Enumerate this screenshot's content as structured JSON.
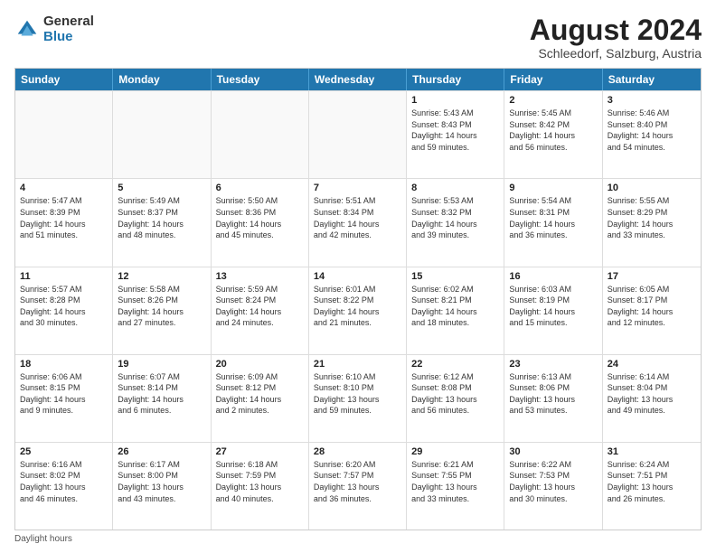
{
  "logo": {
    "general": "General",
    "blue": "Blue"
  },
  "title": "August 2024",
  "subtitle": "Schleedorf, Salzburg, Austria",
  "header_days": [
    "Sunday",
    "Monday",
    "Tuesday",
    "Wednesday",
    "Thursday",
    "Friday",
    "Saturday"
  ],
  "footer": "Daylight hours",
  "weeks": [
    [
      {
        "day": "",
        "info": ""
      },
      {
        "day": "",
        "info": ""
      },
      {
        "day": "",
        "info": ""
      },
      {
        "day": "",
        "info": ""
      },
      {
        "day": "1",
        "info": "Sunrise: 5:43 AM\nSunset: 8:43 PM\nDaylight: 14 hours\nand 59 minutes."
      },
      {
        "day": "2",
        "info": "Sunrise: 5:45 AM\nSunset: 8:42 PM\nDaylight: 14 hours\nand 56 minutes."
      },
      {
        "day": "3",
        "info": "Sunrise: 5:46 AM\nSunset: 8:40 PM\nDaylight: 14 hours\nand 54 minutes."
      }
    ],
    [
      {
        "day": "4",
        "info": "Sunrise: 5:47 AM\nSunset: 8:39 PM\nDaylight: 14 hours\nand 51 minutes."
      },
      {
        "day": "5",
        "info": "Sunrise: 5:49 AM\nSunset: 8:37 PM\nDaylight: 14 hours\nand 48 minutes."
      },
      {
        "day": "6",
        "info": "Sunrise: 5:50 AM\nSunset: 8:36 PM\nDaylight: 14 hours\nand 45 minutes."
      },
      {
        "day": "7",
        "info": "Sunrise: 5:51 AM\nSunset: 8:34 PM\nDaylight: 14 hours\nand 42 minutes."
      },
      {
        "day": "8",
        "info": "Sunrise: 5:53 AM\nSunset: 8:32 PM\nDaylight: 14 hours\nand 39 minutes."
      },
      {
        "day": "9",
        "info": "Sunrise: 5:54 AM\nSunset: 8:31 PM\nDaylight: 14 hours\nand 36 minutes."
      },
      {
        "day": "10",
        "info": "Sunrise: 5:55 AM\nSunset: 8:29 PM\nDaylight: 14 hours\nand 33 minutes."
      }
    ],
    [
      {
        "day": "11",
        "info": "Sunrise: 5:57 AM\nSunset: 8:28 PM\nDaylight: 14 hours\nand 30 minutes."
      },
      {
        "day": "12",
        "info": "Sunrise: 5:58 AM\nSunset: 8:26 PM\nDaylight: 14 hours\nand 27 minutes."
      },
      {
        "day": "13",
        "info": "Sunrise: 5:59 AM\nSunset: 8:24 PM\nDaylight: 14 hours\nand 24 minutes."
      },
      {
        "day": "14",
        "info": "Sunrise: 6:01 AM\nSunset: 8:22 PM\nDaylight: 14 hours\nand 21 minutes."
      },
      {
        "day": "15",
        "info": "Sunrise: 6:02 AM\nSunset: 8:21 PM\nDaylight: 14 hours\nand 18 minutes."
      },
      {
        "day": "16",
        "info": "Sunrise: 6:03 AM\nSunset: 8:19 PM\nDaylight: 14 hours\nand 15 minutes."
      },
      {
        "day": "17",
        "info": "Sunrise: 6:05 AM\nSunset: 8:17 PM\nDaylight: 14 hours\nand 12 minutes."
      }
    ],
    [
      {
        "day": "18",
        "info": "Sunrise: 6:06 AM\nSunset: 8:15 PM\nDaylight: 14 hours\nand 9 minutes."
      },
      {
        "day": "19",
        "info": "Sunrise: 6:07 AM\nSunset: 8:14 PM\nDaylight: 14 hours\nand 6 minutes."
      },
      {
        "day": "20",
        "info": "Sunrise: 6:09 AM\nSunset: 8:12 PM\nDaylight: 14 hours\nand 2 minutes."
      },
      {
        "day": "21",
        "info": "Sunrise: 6:10 AM\nSunset: 8:10 PM\nDaylight: 13 hours\nand 59 minutes."
      },
      {
        "day": "22",
        "info": "Sunrise: 6:12 AM\nSunset: 8:08 PM\nDaylight: 13 hours\nand 56 minutes."
      },
      {
        "day": "23",
        "info": "Sunrise: 6:13 AM\nSunset: 8:06 PM\nDaylight: 13 hours\nand 53 minutes."
      },
      {
        "day": "24",
        "info": "Sunrise: 6:14 AM\nSunset: 8:04 PM\nDaylight: 13 hours\nand 49 minutes."
      }
    ],
    [
      {
        "day": "25",
        "info": "Sunrise: 6:16 AM\nSunset: 8:02 PM\nDaylight: 13 hours\nand 46 minutes."
      },
      {
        "day": "26",
        "info": "Sunrise: 6:17 AM\nSunset: 8:00 PM\nDaylight: 13 hours\nand 43 minutes."
      },
      {
        "day": "27",
        "info": "Sunrise: 6:18 AM\nSunset: 7:59 PM\nDaylight: 13 hours\nand 40 minutes."
      },
      {
        "day": "28",
        "info": "Sunrise: 6:20 AM\nSunset: 7:57 PM\nDaylight: 13 hours\nand 36 minutes."
      },
      {
        "day": "29",
        "info": "Sunrise: 6:21 AM\nSunset: 7:55 PM\nDaylight: 13 hours\nand 33 minutes."
      },
      {
        "day": "30",
        "info": "Sunrise: 6:22 AM\nSunset: 7:53 PM\nDaylight: 13 hours\nand 30 minutes."
      },
      {
        "day": "31",
        "info": "Sunrise: 6:24 AM\nSunset: 7:51 PM\nDaylight: 13 hours\nand 26 minutes."
      }
    ]
  ]
}
